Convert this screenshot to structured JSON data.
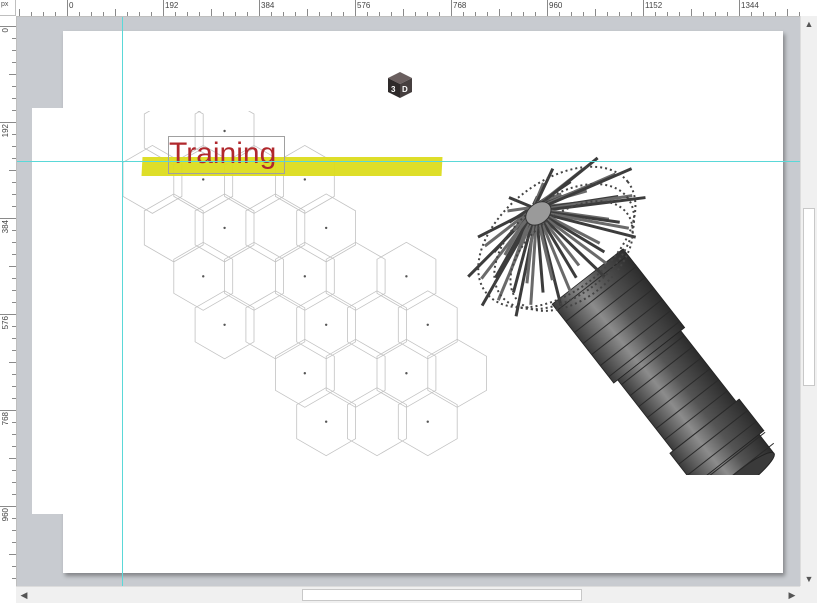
{
  "ruler": {
    "unit": "px",
    "top_labels": [
      "0",
      "192",
      "384",
      "576",
      "768",
      "960",
      "1152",
      "1344"
    ],
    "left_labels": [
      "0",
      "192",
      "384",
      "576",
      "768",
      "960"
    ]
  },
  "slide": {
    "title": "Training",
    "highlight_color": "#dcdc1e",
    "title_color": "#b0282d"
  },
  "icons": {
    "cube": "3d-cube-icon",
    "scroll_up": "arrow-up-icon",
    "scroll_down": "arrow-down-icon",
    "scroll_left": "arrow-left-icon",
    "scroll_right": "arrow-right-icon"
  },
  "colors": {
    "guides": "#5ad8d8",
    "canvas_bg": "#c8cbd0",
    "engine": "#5a5a5a"
  }
}
